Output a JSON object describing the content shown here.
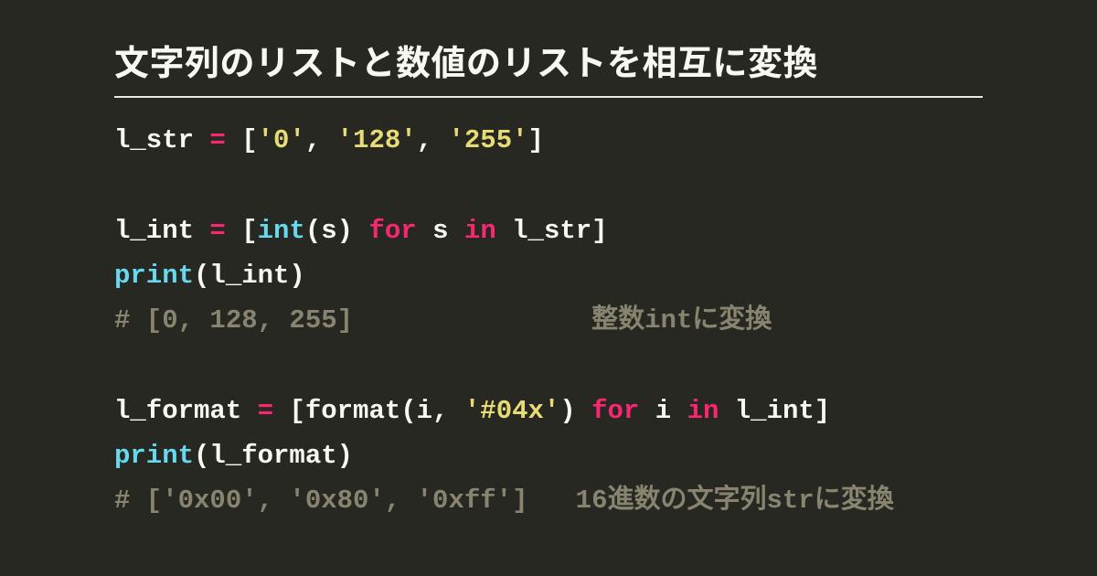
{
  "title": "文字列のリストと数値のリストを相互に変換",
  "code": {
    "l1": {
      "a": "l_str ",
      "b": "=",
      "c": " [",
      "d": "'0'",
      "e": ", ",
      "f": "'128'",
      "g": ", ",
      "h": "'255'",
      "i": "]"
    },
    "l2": {
      "a": "l_int ",
      "b": "=",
      "c": " [",
      "d": "int",
      "e": "(s) ",
      "f": "for",
      "g": " s ",
      "h": "in",
      "i": " l_str]"
    },
    "l3": {
      "a": "print",
      "b": "(l_int)"
    },
    "l4": {
      "a": "# [0, 128, 255]               整数intに変換"
    },
    "l5": {
      "a": "l_format ",
      "b": "=",
      "c": " [format(i, ",
      "d": "'#04x'",
      "e": ") ",
      "f": "for",
      "g": " i ",
      "h": "in",
      "i": " l_int]"
    },
    "l6": {
      "a": "print",
      "b": "(l_format)"
    },
    "l7": {
      "a": "# ['0x00', '0x80', '0xff']   16進数の文字列strに変換"
    }
  }
}
